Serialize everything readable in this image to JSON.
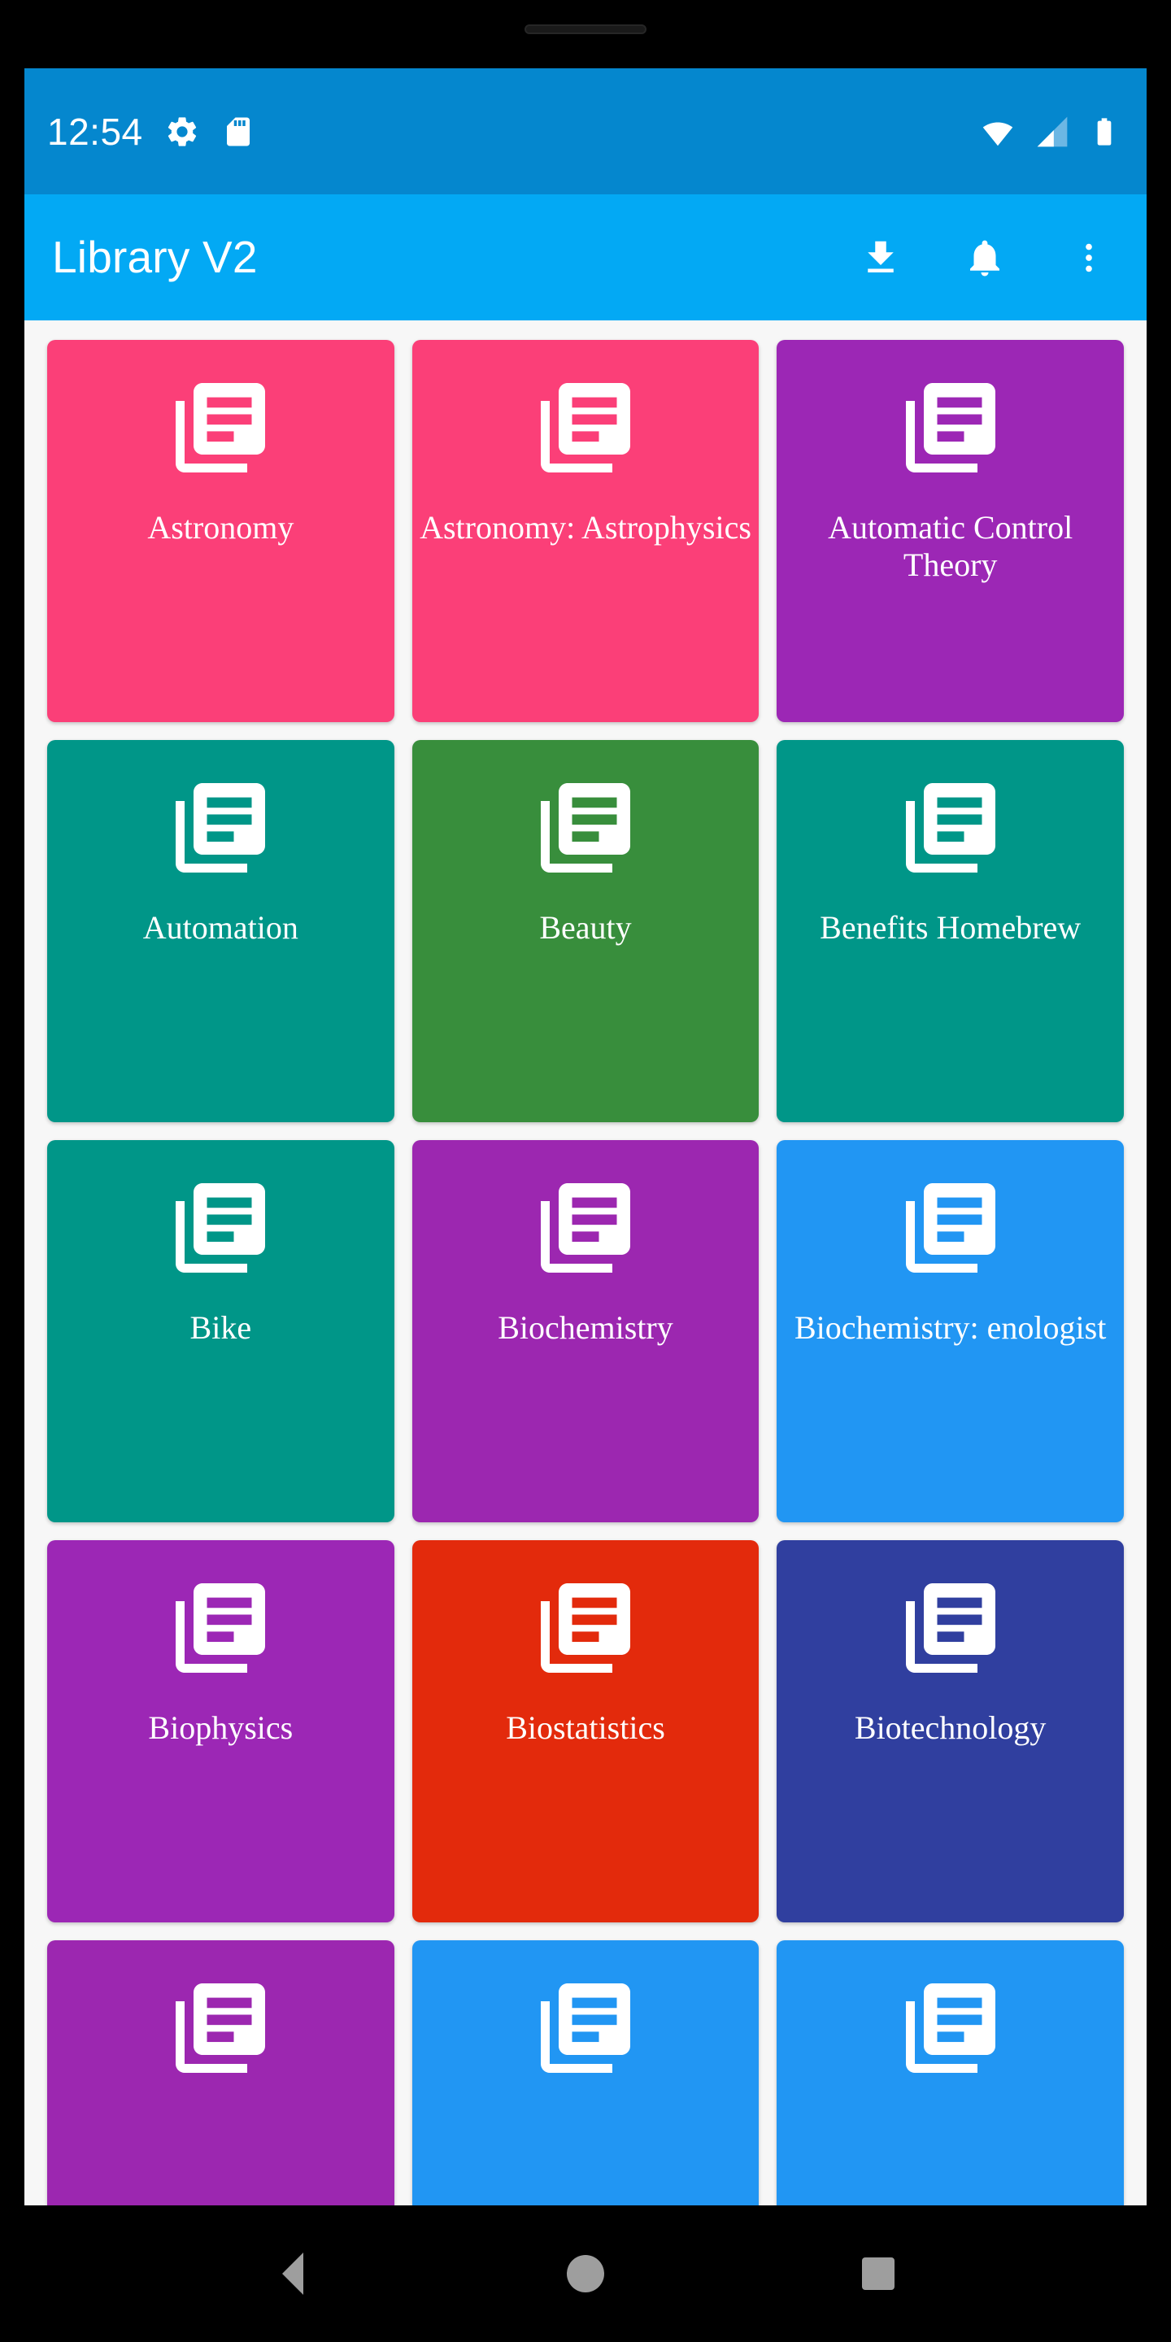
{
  "status_bar": {
    "time": "12:54",
    "background": "#0587ce",
    "left_icons": [
      "gear-icon",
      "sd-card-icon"
    ],
    "right_icons": [
      "wifi-icon",
      "cellular-signal-icon",
      "battery-icon"
    ]
  },
  "app_bar": {
    "title": "Library V2",
    "background": "#03A9F4",
    "actions": [
      {
        "name": "download-icon",
        "label": "Download"
      },
      {
        "name": "notifications-icon",
        "label": "Notifications"
      },
      {
        "name": "overflow-menu-icon",
        "label": "More options"
      }
    ]
  },
  "grid": {
    "columns": 3,
    "background": "#f7f7f7",
    "tiles": [
      {
        "label": "Astronomy",
        "color": "#FB3F78"
      },
      {
        "label": "Astronomy: Astrophysics",
        "color": "#FB3F78"
      },
      {
        "label": "Automatic Control Theory",
        "color": "#9C27B5"
      },
      {
        "label": "Automation",
        "color": "#009688"
      },
      {
        "label": "Beauty",
        "color": "#388E3C"
      },
      {
        "label": "Benefits Homebrew",
        "color": "#009688"
      },
      {
        "label": "Bike",
        "color": "#009688"
      },
      {
        "label": "Biochemistry",
        "color": "#9C27B0"
      },
      {
        "label": "Biochemistry: enologist",
        "color": "#2196F3"
      },
      {
        "label": "Biophysics",
        "color": "#9C27B5"
      },
      {
        "label": "Biostatistics",
        "color": "#E32A0C"
      },
      {
        "label": "Biotechnology",
        "color": "#303F9F"
      },
      {
        "label": "",
        "color": "#9C27B0"
      },
      {
        "label": "",
        "color": "#2196F3"
      },
      {
        "label": "",
        "color": "#2196F3"
      }
    ]
  },
  "nav_bar": {
    "background": "#000000",
    "buttons": [
      {
        "name": "nav-back-button",
        "label": "Back"
      },
      {
        "name": "nav-home-button",
        "label": "Home"
      },
      {
        "name": "nav-recents-button",
        "label": "Recent apps"
      }
    ]
  }
}
